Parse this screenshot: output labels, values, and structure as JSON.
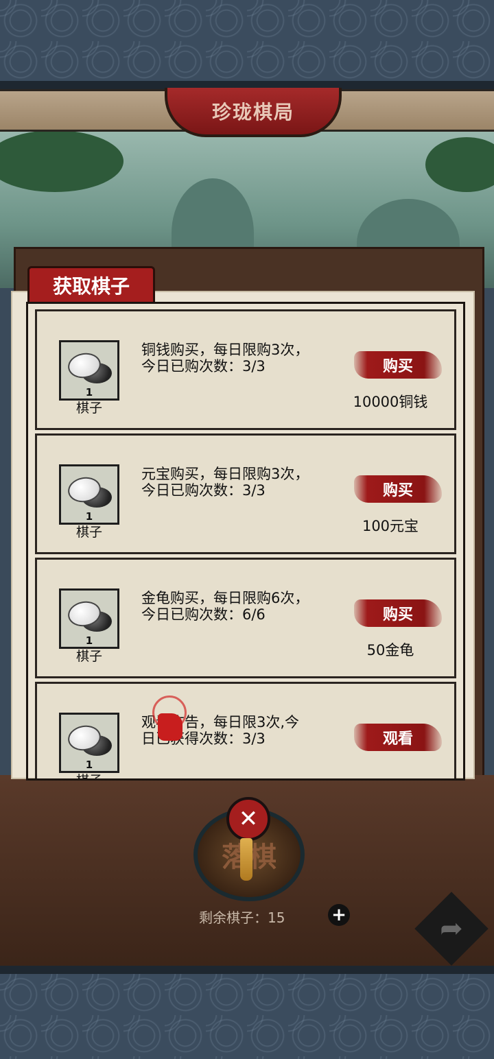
{
  "title": "珍珑棋局",
  "dialog": {
    "header": "获取棋子",
    "items": [
      {
        "icon": "white-black-stones-icon",
        "count": "1",
        "name": "棋子",
        "desc_line1": "铜钱购买，每日限购3次，",
        "desc_line2": "今日已购次数：3/3",
        "button": "购买",
        "price": "10000铜钱"
      },
      {
        "icon": "white-black-stones-icon",
        "count": "1",
        "name": "棋子",
        "desc_line1": "元宝购买，每日限购3次，",
        "desc_line2": "今日已购次数：3/3",
        "button": "购买",
        "price": "100元宝"
      },
      {
        "icon": "white-black-stones-icon",
        "count": "1",
        "name": "棋子",
        "desc_line1": "金龟购买，每日限购6次，",
        "desc_line2": "今日已购次数：6/6",
        "button": "购买",
        "price": "50金龟"
      },
      {
        "icon": "white-black-stones-icon",
        "count": "1",
        "name": "棋子",
        "desc_line1": "观看广告，每日限3次,今",
        "desc_line2": "日已获得次数：3/3",
        "button": "观看",
        "price": ""
      }
    ]
  },
  "bottom": {
    "place_label": "落棋",
    "close_symbol": "✕",
    "remaining": "剩余棋子：15",
    "plus_symbol": "+",
    "share_symbol": "➦"
  },
  "colors": {
    "accent_red": "#a51e1e",
    "paper": "#ebe4d4"
  }
}
